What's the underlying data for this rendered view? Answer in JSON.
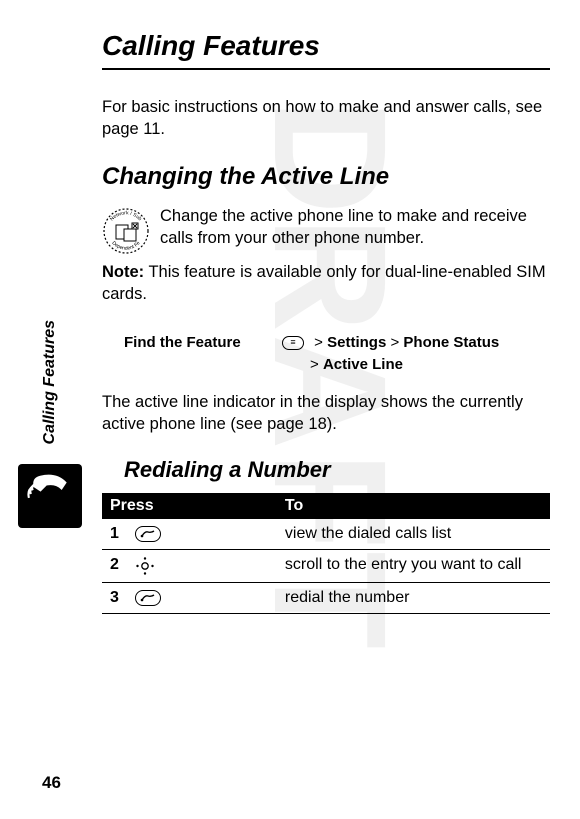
{
  "side_label": "Calling Features",
  "page_number": "46",
  "chapter_title": "Calling Features",
  "intro": "For basic instructions on how to make and answer calls, see page 11.",
  "section1": {
    "heading": "Changing the Active Line",
    "p1": "Change the active phone line to make and receive calls from your other phone number.",
    "note_label": "Note:",
    "note_text": " This feature is available only for dual-line-enabled SIM cards.",
    "find_label": "Find the Feature",
    "menu_glyph": "≡",
    "path_line1a": "> ",
    "path_line1b": "Settings",
    "path_line1c": " > ",
    "path_line1d": "Phone Status",
    "path_line2a": "> ",
    "path_line2b": "Active Line",
    "outro": "The active line indicator in the display shows the currently active phone line (see page 18)."
  },
  "section2": {
    "heading": "Redialing a Number",
    "th_press": "Press",
    "th_to": "To",
    "rows": [
      {
        "n": "1",
        "key": "send",
        "desc": "view the dialed calls list"
      },
      {
        "n": "2",
        "key": "nav",
        "desc": "scroll to the entry you want to call"
      },
      {
        "n": "3",
        "key": "send",
        "desc": "redial the number"
      }
    ]
  }
}
